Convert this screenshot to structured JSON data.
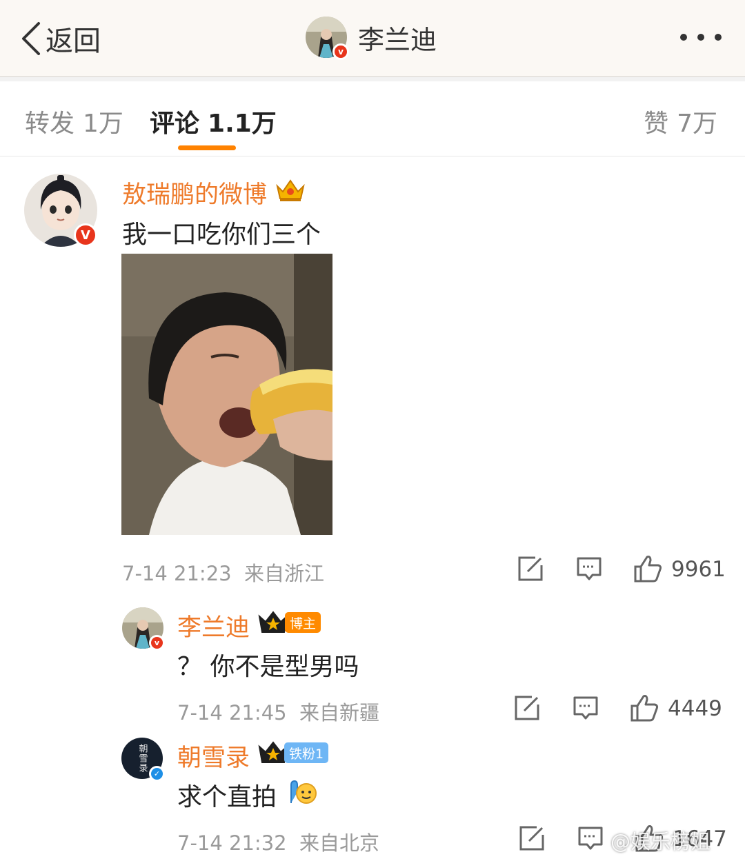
{
  "header": {
    "back_label": "返回",
    "title": "李兰迪"
  },
  "tabs": [
    {
      "label": "转发",
      "count": "1万"
    },
    {
      "label": "评论",
      "count": "1.1万"
    },
    {
      "label": "赞",
      "count": "7万"
    }
  ],
  "comments": [
    {
      "user": "敖瑞鹏的微博",
      "text": "我一口吃你们三个",
      "time": "7-14 21:23",
      "location": "来自浙江",
      "likes": "9961",
      "verified": "orange"
    },
    {
      "user": "李兰迪",
      "badge": "博主",
      "text": "？ 你不是型男吗",
      "time": "7-14 21:45",
      "location": "来自新疆",
      "likes": "4449",
      "verified": "orange"
    },
    {
      "user": "朝雪录",
      "badge": "铁粉1",
      "avatar_text": "朝雪录",
      "text": "求个直拍",
      "time": "7-14 21:32",
      "location": "来自北京",
      "likes": "1647",
      "verified": "blue"
    }
  ],
  "watermark": "@娱乐榜姐",
  "colors": {
    "accent": "#ff8200",
    "username": "#ee7a2a",
    "verified_orange": "#e8351c",
    "verified_blue": "#1d8fe6"
  }
}
